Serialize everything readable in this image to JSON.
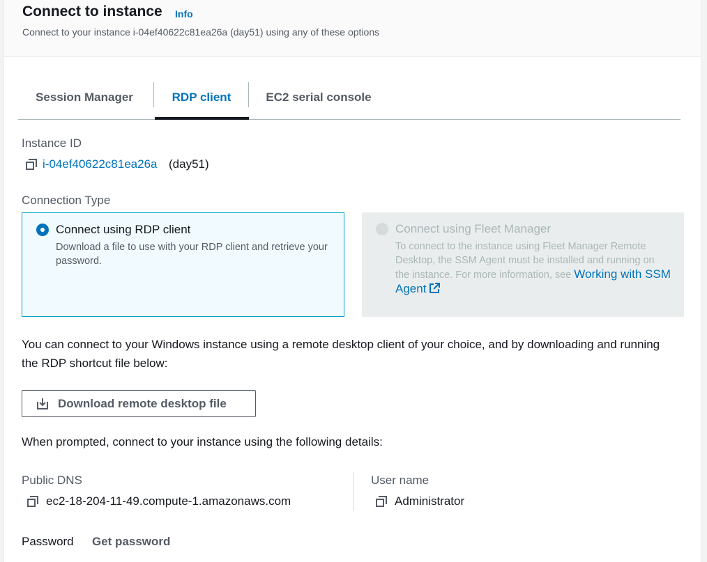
{
  "header": {
    "title": "Connect to instance",
    "info_label": "Info",
    "subtitle": "Connect to your instance i-04ef40622c81ea26a (day51) using any of these options"
  },
  "tabs": [
    {
      "label": "Session Manager",
      "active": false
    },
    {
      "label": "RDP client",
      "active": true
    },
    {
      "label": "EC2 serial console",
      "active": false
    }
  ],
  "instance": {
    "label": "Instance ID",
    "id": "i-04ef40622c81ea26a",
    "name": "(day51)"
  },
  "connection_type": {
    "label": "Connection Type",
    "options": [
      {
        "title": "Connect using RDP client",
        "description": "Download a file to use with your RDP client and retrieve your password.",
        "selected": true
      },
      {
        "title": "Connect using Fleet Manager",
        "description": "To connect to the instance using Fleet Manager Remote Desktop, the SSM Agent must be installed and running on the instance. For more information, see",
        "link_text": "Working with SSM Agent",
        "selected": false,
        "disabled": true
      }
    ]
  },
  "rdp": {
    "intro": "You can connect to your Windows instance using a remote desktop client of your choice, and by downloading and running the RDP shortcut file below:",
    "download_label": "Download remote desktop file",
    "prompt": "When prompted, connect to your instance using the following details:",
    "public_dns_label": "Public DNS",
    "public_dns": "ec2-18-204-11-49.compute-1.amazonaws.com",
    "username_label": "User name",
    "username": "Administrator",
    "password_label": "Password",
    "get_password_label": "Get password"
  },
  "colors": {
    "accent": "#0073bb",
    "selected_border": "#00a1c9",
    "selected_bg": "#f1faff",
    "disabled_bg": "#eaeded"
  }
}
